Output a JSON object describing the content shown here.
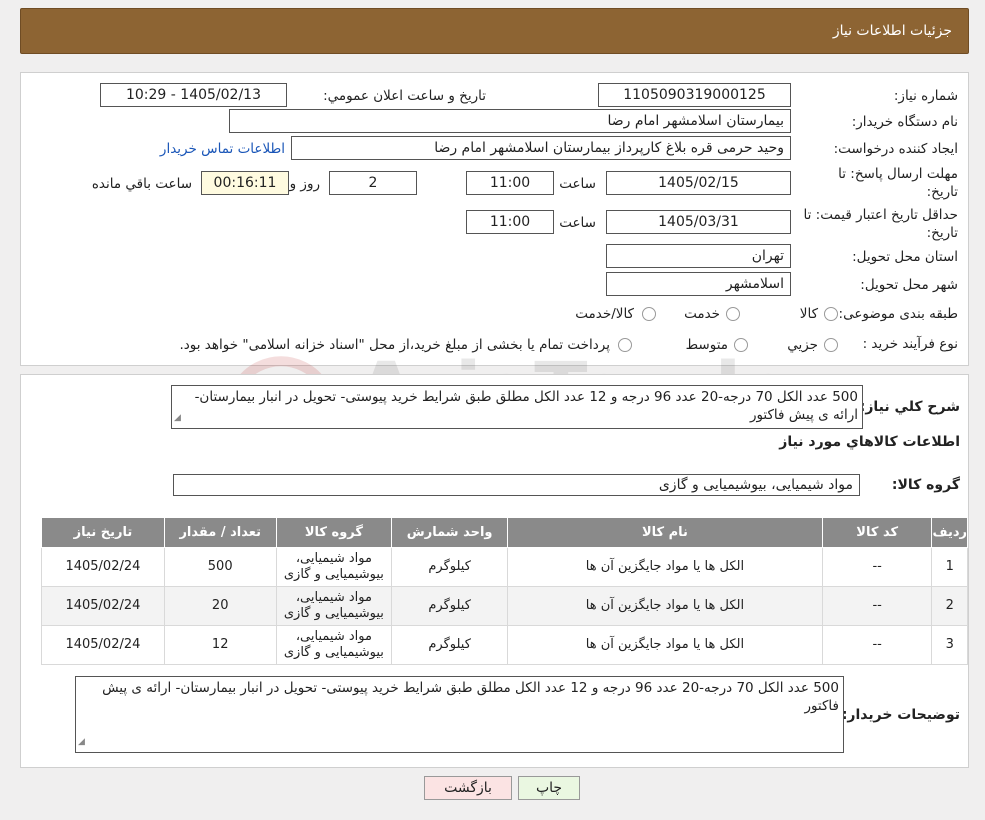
{
  "page_title": "جزئيات اطلاعات نياز",
  "watermark": "AriaTender.neT",
  "info": {
    "need_number_label": "شماره نياز:",
    "need_number": "1105090319000125",
    "announce_label": "تاريخ و ساعت اعلان عمومي:",
    "announce_value": "1405/02/13 - 10:29",
    "buyer_org_label": "نام دستگاه خريدار:",
    "buyer_org": "بيمارستان اسلامشهر   امام رضا",
    "requester_label": "ايجاد کننده درخواست:",
    "requester": "وحيد حرمی قره بلاغ کارپرداز بيمارستان اسلامشهر   امام رضا",
    "contact_link": "اطلاعات تماس خريدار",
    "reply_deadline_label": "مهلت ارسال پاسخ: تا تاريخ:",
    "reply_date": "1405/02/15",
    "time_word": "ساعت",
    "reply_time": "11:00",
    "days_value": "2",
    "days_word": "روز و",
    "remaining_time": "00:16:11",
    "remaining_label": "ساعت باقي مانده",
    "price_validity_label": "حداقل تاريخ اعتبار قيمت: تا تاريخ:",
    "validity_date": "1405/03/31",
    "validity_time": "11:00",
    "province_label": "استان محل تحويل:",
    "province": "تهران",
    "city_label": "شهر محل تحويل:",
    "city": "اسلامشهر",
    "category_label": "طبقه بندی موضوعی:",
    "category_options": [
      "کالا",
      "خدمت",
      "کالا/خدمت"
    ],
    "process_label": "نوع فرآيند خريد :",
    "process_options": [
      "جزيي",
      "متوسط"
    ],
    "process_note": "پرداخت تمام يا بخشی از مبلغ خريد،از محل \"اسناد خزانه اسلامی\" خواهد بود."
  },
  "details": {
    "summary_label": "شرح کلي نياز:",
    "summary": "500 عدد الکل 70 درجه-20 عدد 96 درجه و 12 عدد الکل مطلق طبق شرايط خريد پيوستی- تحويل در انبار بيمارستان- ارائه ی پيش فاکتور",
    "goods_info_title": "اطلاعات کالاهاي مورد نياز",
    "goods_group_label": "گروه کالا:",
    "goods_group": "مواد شيميايی، بيوشيميايی و  گازی",
    "table": {
      "headers": [
        "رديف",
        "کد کالا",
        "نام کالا",
        "واحد شمارش",
        "گروه کالا",
        "تعداد / مقدار",
        "تاريخ نياز"
      ],
      "rows": [
        [
          "1",
          "--",
          "الکل ها يا مواد جايگزين آن ها",
          "کيلوگرم",
          "مواد شيميايی، بيوشيميايی و گازی",
          "500",
          "1405/02/24"
        ],
        [
          "2",
          "--",
          "الکل ها يا مواد جايگزين آن ها",
          "کيلوگرم",
          "مواد شيميايی، بيوشيميايی و گازی",
          "20",
          "1405/02/24"
        ],
        [
          "3",
          "--",
          "الکل ها يا مواد جايگزين آن ها",
          "کيلوگرم",
          "مواد شيميايی، بيوشيميايی و گازی",
          "12",
          "1405/02/24"
        ]
      ]
    },
    "buyer_notes_label": "توضيحات خريدار:",
    "buyer_notes": "500 عدد الکل 70 درجه-20 عدد 96 درجه و 12 عدد الکل مطلق طبق شرايط خريد پيوستی- تحويل در انبار بيمارستان- ارائه ی پيش فاکتور"
  },
  "buttons": {
    "print": "چاپ",
    "back": "بازگشت"
  },
  "colors": {
    "titlebar": "#8d6433",
    "table_header": "#8a8a8a",
    "link": "#1a56b8",
    "print_button": "#eaf7e1",
    "back_button": "#fbe3e3"
  }
}
